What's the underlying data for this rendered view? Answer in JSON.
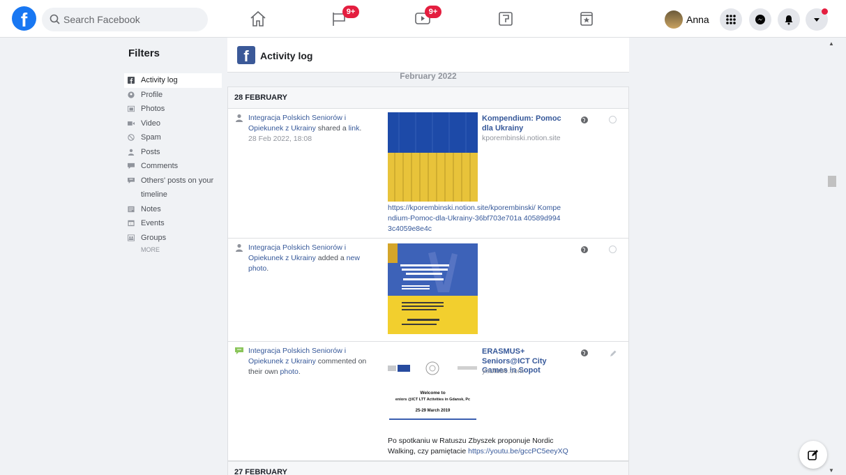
{
  "topbar": {
    "logo_letter": "f",
    "search_placeholder": "Search Facebook",
    "nav": [
      {
        "name": "home",
        "badge": ""
      },
      {
        "name": "pages",
        "badge": "9+"
      },
      {
        "name": "watch",
        "badge": "9+"
      },
      {
        "name": "gaming",
        "badge": ""
      },
      {
        "name": "events",
        "badge": ""
      }
    ],
    "user_name": "Anna",
    "accent": "#1877f2",
    "badge_color": "#e41e3f"
  },
  "filters": {
    "title": "Filters",
    "items": [
      {
        "label": "Activity log",
        "icon": "facebook-icon",
        "active": true
      },
      {
        "label": "Profile",
        "icon": "profile-icon"
      },
      {
        "label": "Photos",
        "icon": "photos-icon"
      },
      {
        "label": "Video",
        "icon": "video-icon"
      },
      {
        "label": "Spam",
        "icon": "spam-icon"
      },
      {
        "label": "Posts",
        "icon": "posts-icon"
      },
      {
        "label": "Comments",
        "icon": "comments-icon"
      },
      {
        "label": "Others' posts on your",
        "icon": "others-posts-icon"
      },
      {
        "label": "timeline",
        "icon": ""
      },
      {
        "label": "Notes",
        "icon": "notes-icon"
      },
      {
        "label": "Events",
        "icon": "events-icon"
      },
      {
        "label": "Groups",
        "icon": "groups-icon"
      }
    ],
    "more": "MORE"
  },
  "main": {
    "header_logo": "f",
    "title": "Activity log",
    "month": "February 2022",
    "day1": "28 FEBRUARY",
    "day2": "27 FEBRUARY",
    "entries": [
      {
        "author": "Integracja Polskich Seniorów i Opiekunek z Ukrainy",
        "action": " shared a ",
        "object": "link",
        "end": ".",
        "date": "28 Feb 2022, 18:08",
        "link_title": "Kompendium: Pomoc dla Ukrainy",
        "domain": "kporembinski.notion.site",
        "url": "https://kporembinski.notion.site/kporembinski/ Kompendium-Pomoc-dla-Ukrainy-36bf703e701a 40589d9943c4059e8e4c"
      },
      {
        "author": "Integracja Polskich Seniorów i Opiekunek z Ukrainy",
        "action": " added a ",
        "object": "new photo",
        "end": "."
      },
      {
        "author": "Integracja Polskich Seniorów i Opiekunek z Ukrainy",
        "action": " commented on their own ",
        "object": "photo",
        "end": ".",
        "link_title": "ERASMUS+ Seniors@ICT City Games in Sopot",
        "domain": "youtube.com",
        "thumb_lines": [
          "Welcome to",
          "eniors @ICT LTT Activities in Gdansk, Pc",
          "25-29 March 2019"
        ],
        "caption": "Po spotkaniu w Ratuszu Zbyszek proponuje Nordic Walking, czy pamiętacie ",
        "caption_link": "https://youtu.be/gccPC5eeyXQ"
      }
    ]
  }
}
